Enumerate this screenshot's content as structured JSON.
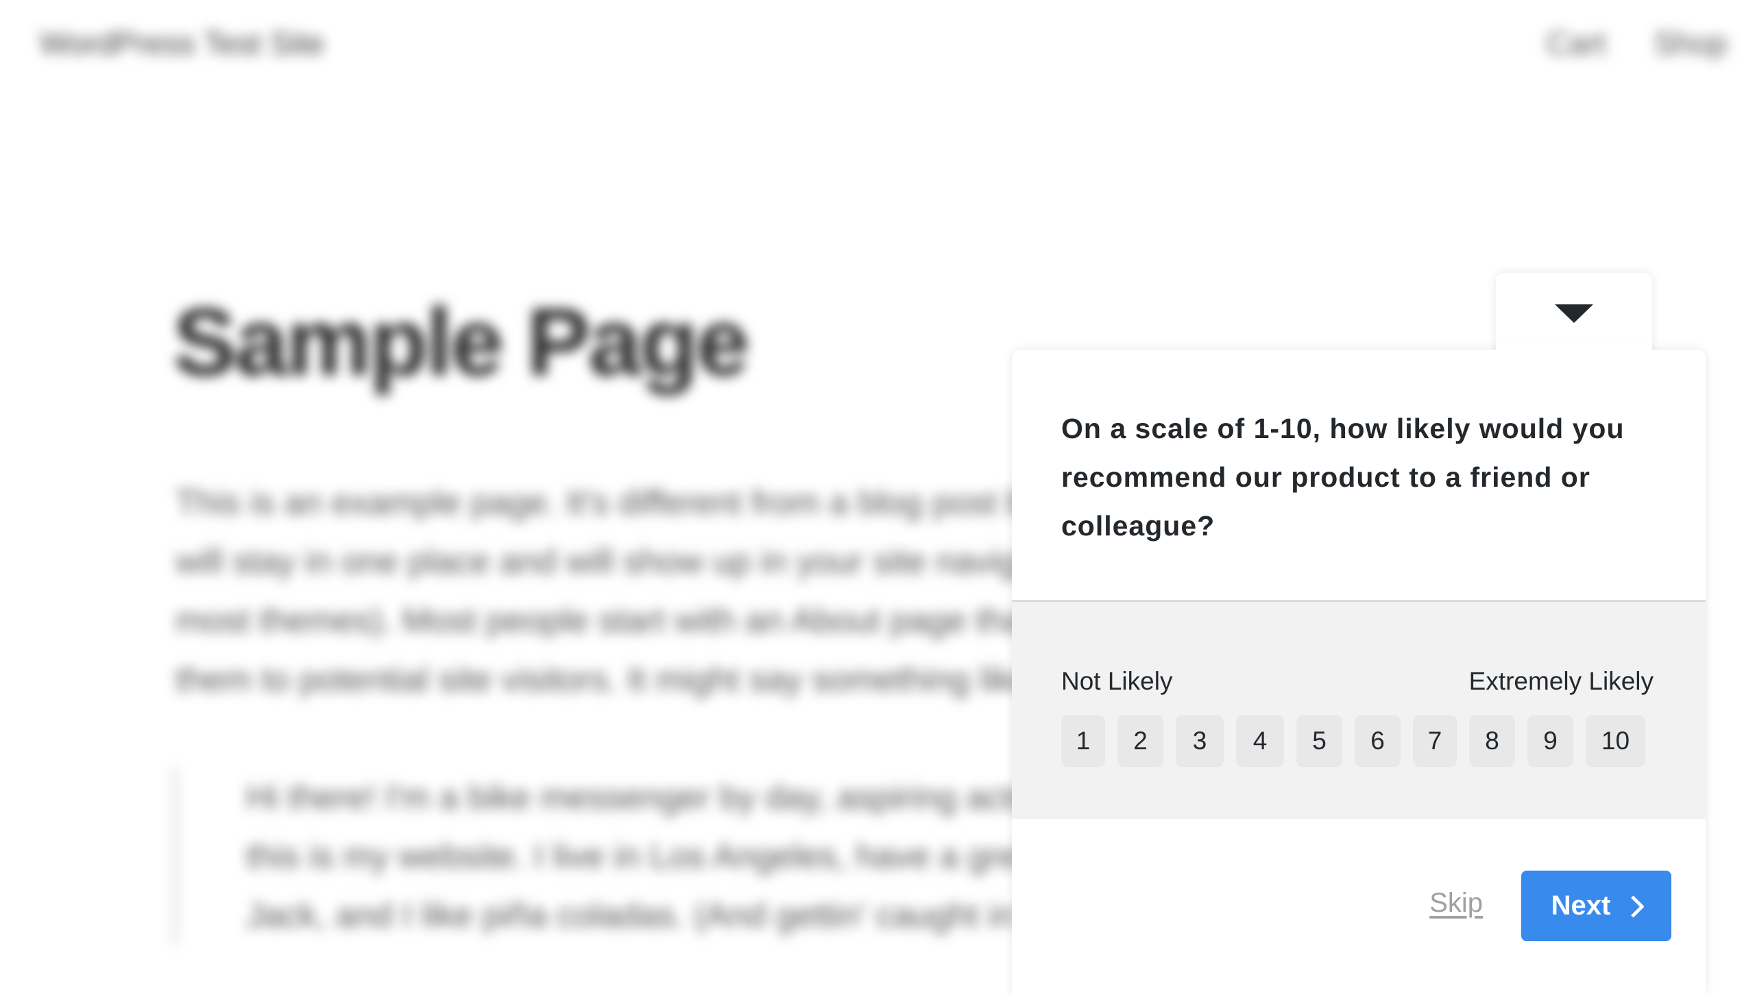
{
  "site": {
    "title": "WordPress Test Site",
    "nav": [
      "Cart",
      "Shop"
    ]
  },
  "page": {
    "title": "Sample Page",
    "paragraph": "This is an example page. It's different from a blog post because it will stay in one place and will show up in your site navigation (in most themes). Most people start with an About page that introduces them to potential site visitors. It might say something like this:",
    "quote": "Hi there! I'm a bike messenger by day, aspiring actor by night, and this is my website. I live in Los Angeles, have a great dog named Jack, and I like piña coladas. (And gettin' caught in the rain.)"
  },
  "survey": {
    "collapse_icon": "caret-down-icon",
    "question": "On a scale of 1-10, how likely would you recommend our product to a friend or colleague?",
    "label_low": "Not Likely",
    "label_high": "Extremely Likely",
    "scale": [
      "1",
      "2",
      "3",
      "4",
      "5",
      "6",
      "7",
      "8",
      "9",
      "10"
    ],
    "skip_label": "Skip",
    "next_label": "Next",
    "next_icon": "chevron-right-icon",
    "colors": {
      "primary": "#388bec",
      "text": "#23282d",
      "rating_bg": "#f2f2f2",
      "scale_btn_bg": "#e8e8e8",
      "skip": "#a0a0a0"
    }
  }
}
